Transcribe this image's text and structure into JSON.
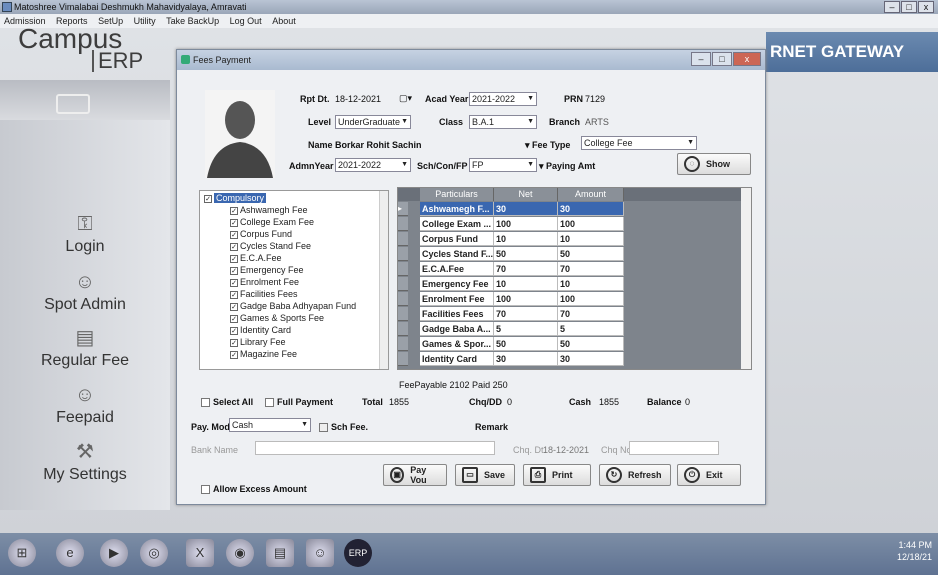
{
  "window_title": "Matoshree Vimalabai Deshmukh Mahavidyalaya, Amravati",
  "menu": [
    "Admission",
    "Reports",
    "SetUp",
    "Utility",
    "Take BackUp",
    "Log Out",
    "About"
  ],
  "brand": {
    "campus": "Campus",
    "erp": "ERP",
    "gateway": "RNET GATEWAY"
  },
  "sidebar": [
    "Login",
    "Spot Admin",
    "Regular Fee",
    "Feepaid",
    "My Settings"
  ],
  "dialog": {
    "title": "Fees Payment",
    "rpt_dt_label": "Rpt Dt.",
    "rpt_dt": "18-12-2021",
    "acad_year_label": "Acad Year",
    "acad_year": "2021-2022",
    "prn_label": "PRN",
    "prn": "7129",
    "level_label": "Level",
    "level": "UnderGraduate",
    "class_label": "Class",
    "class": "B.A.1",
    "branch_label": "Branch",
    "branch": "ARTS",
    "name_label": "Name",
    "name": "Borkar Rohit Sachin",
    "fee_type_label": "Fee Type",
    "fee_type": "College Fee",
    "admn_year_label": "AdmnYear",
    "admn_year": "2021-2022",
    "sch_label": "Sch/Con/FP",
    "sch": "FP",
    "paying_amt_label": "Paying Amt",
    "show_btn": "Show"
  },
  "tree": {
    "root": "Compulsory",
    "items": [
      "Ashwamegh Fee",
      "College Exam Fee",
      "Corpus Fund",
      "Cycles Stand Fee",
      "E.C.A.Fee",
      "Emergency Fee",
      "Enrolment Fee",
      "Facilities Fees",
      "Gadge Baba Adhyapan Fund",
      "Games & Sports Fee",
      "Identity Card",
      "Library Fee",
      "Magazine Fee"
    ]
  },
  "grid": {
    "headers": [
      "Particulars",
      "Net",
      "Amount"
    ],
    "rows": [
      [
        "Ashwamegh F...",
        "30",
        "30"
      ],
      [
        "College Exam ...",
        "100",
        "100"
      ],
      [
        "Corpus Fund",
        "10",
        "10"
      ],
      [
        "Cycles Stand F...",
        "50",
        "50"
      ],
      [
        "E.C.A.Fee",
        "70",
        "70"
      ],
      [
        "Emergency Fee",
        "10",
        "10"
      ],
      [
        "Enrolment Fee",
        "100",
        "100"
      ],
      [
        "Facilities Fees",
        "70",
        "70"
      ],
      [
        "Gadge Baba A...",
        "5",
        "5"
      ],
      [
        "Games & Spor...",
        "50",
        "50"
      ],
      [
        "Identity Card",
        "30",
        "30"
      ]
    ]
  },
  "summary": {
    "fee_payable": "FeePayable  2102  Paid  250",
    "select_all": "Select All",
    "full_payment": "Full Payment",
    "total_label": "Total",
    "total": "1855",
    "chq_label": "Chq/DD",
    "chq": "0",
    "cash_label": "Cash",
    "cash": "1855",
    "balance_label": "Balance",
    "balance": "0",
    "pay_mode_label": "Pay. Mode",
    "pay_mode": "Cash",
    "sch_fee": "Sch Fee.",
    "remark_label": "Remark",
    "bank_label": "Bank Name",
    "chq_dt_label": "Chq. Dt.",
    "chq_dt": "18-12-2021",
    "chq_no_label": "Chq No",
    "allow_excess": "Allow Excess Amount"
  },
  "buttons": [
    "Pay Vou",
    "Save",
    "Print",
    "Refresh",
    "Exit"
  ],
  "tray": {
    "time": "1:44 PM",
    "date": "12/18/21"
  }
}
